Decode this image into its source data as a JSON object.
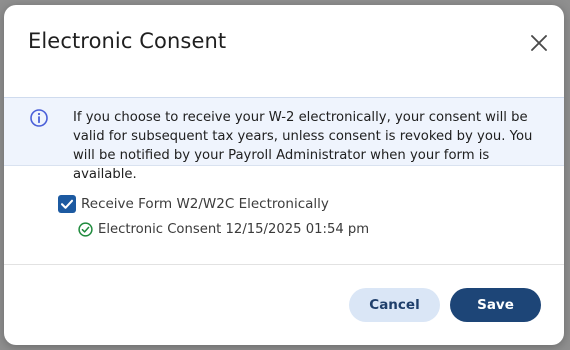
{
  "dialog": {
    "title": "Electronic Consent",
    "close_icon": "close-icon"
  },
  "info": {
    "icon": "info-icon",
    "text": "If you choose to receive your W-2 electronically, your consent will be valid for subsequent tax years, unless consent is revoked by you. You will be notified by your Payroll Administrator when your form is available."
  },
  "consent": {
    "checkbox_label": "Receive Form W2/W2C Electronically",
    "checked": true,
    "status_icon": "check-circle-icon",
    "status_text": "Electronic Consent 12/15/2025 01:54 pm"
  },
  "actions": {
    "cancel_label": "Cancel",
    "save_label": "Save"
  },
  "colors": {
    "primary": "#1d4577",
    "checkbox": "#1c5aa1",
    "banner_bg": "#eff4fd",
    "secondary_button_bg": "#dae6f6",
    "success": "#1e8a3c"
  }
}
